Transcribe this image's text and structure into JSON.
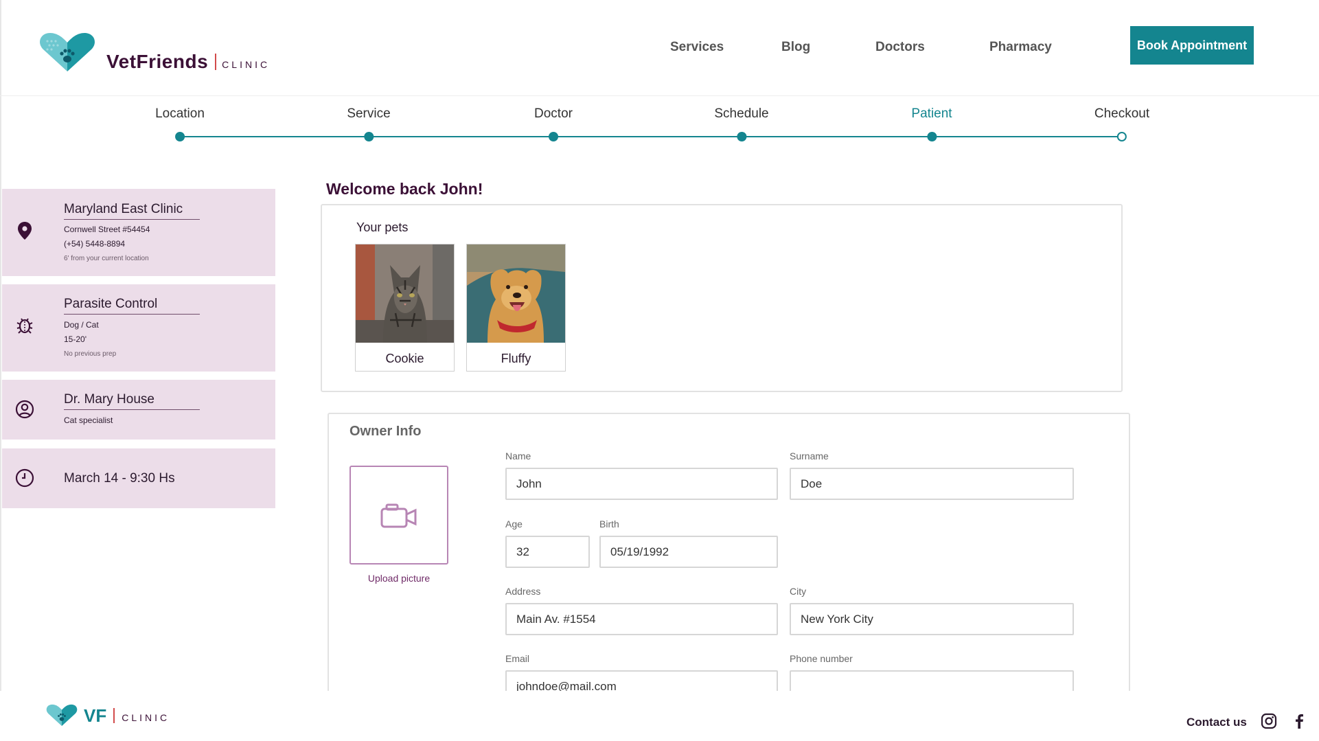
{
  "header": {
    "brand": "VetFriends",
    "brand_sub": "CLINIC",
    "nav": [
      "Services",
      "Blog",
      "Doctors",
      "Pharmacy"
    ],
    "book_label": "Book Appointment"
  },
  "stepper": {
    "steps": [
      "Location",
      "Service",
      "Doctor",
      "Schedule",
      "Patient",
      "Checkout"
    ],
    "active": "Patient"
  },
  "summary": {
    "location": {
      "icon": "location-pin-icon",
      "title": "Maryland East Clinic",
      "street": "Cornwell Street #54454",
      "phone": "(+54) 5448-8894",
      "note": "6' from your current location"
    },
    "service": {
      "icon": "bug-icon",
      "title": "Parasite Control",
      "species": "Dog / Cat",
      "duration": "15-20'",
      "note": "No previous prep"
    },
    "doctor": {
      "icon": "user-circle-icon",
      "title": "Dr. Mary House",
      "specialty": "Cat specialist"
    },
    "schedule": {
      "icon": "clock-icon",
      "title": "March 14 - 9:30 Hs"
    }
  },
  "main": {
    "welcome": "Welcome back John!",
    "pets_title": "Your pets",
    "pets": [
      {
        "name": "Cookie"
      },
      {
        "name": "Fluffy"
      }
    ]
  },
  "owner": {
    "title": "Owner Info",
    "upload_label": "Upload picture",
    "fields": {
      "name": {
        "label": "Name",
        "value": "John"
      },
      "surname": {
        "label": "Surname",
        "value": "Doe"
      },
      "age": {
        "label": "Age",
        "value": "32"
      },
      "birth": {
        "label": "Birth",
        "value": "05/19/1992"
      },
      "address": {
        "label": "Address",
        "value": "Main Av. #1554"
      },
      "city": {
        "label": "City",
        "value": "New York City"
      },
      "email": {
        "label": "Email",
        "value": "johndoe@mail.com"
      },
      "phone": {
        "label": "Phone number",
        "value": ""
      }
    }
  },
  "footer": {
    "short_brand": "VF",
    "brand_sub": "CLINIC",
    "contact": "Contact us",
    "social": [
      "instagram-icon",
      "facebook-icon"
    ]
  },
  "colors": {
    "brand_teal": "#14858f",
    "brand_plum": "#3b1036",
    "card_bg": "#ecdde9",
    "accent_red": "#d24a4a"
  }
}
